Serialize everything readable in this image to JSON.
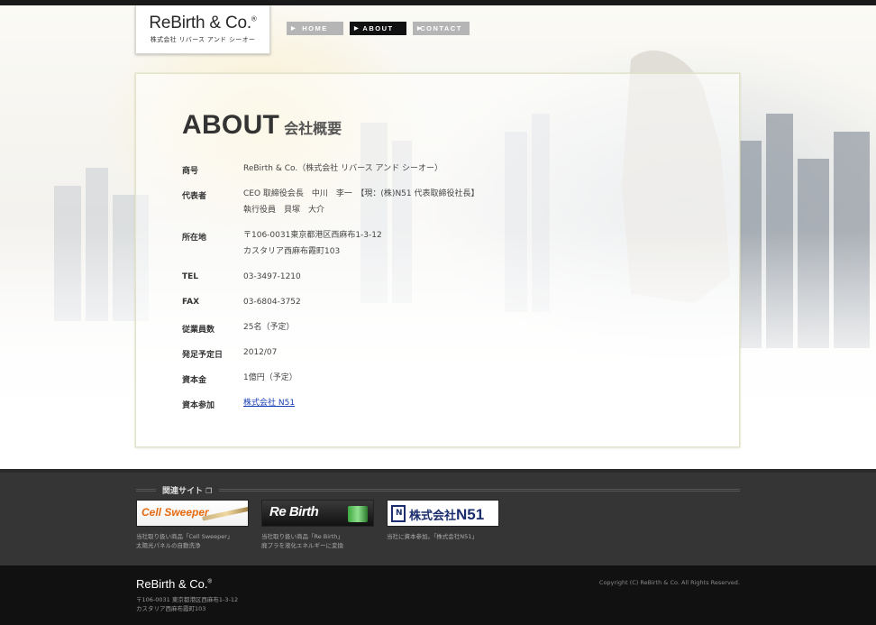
{
  "brand": {
    "logo_main": "ReBirth & Co.",
    "logo_mark": "®",
    "logo_sub": "株式会社 リバース アンド シーオー"
  },
  "nav": {
    "items": [
      {
        "label": "HOME",
        "active": false
      },
      {
        "label": "ABOUT",
        "active": true
      },
      {
        "label": "CONTACT",
        "active": false
      }
    ]
  },
  "page": {
    "title_en": "ABOUT",
    "title_ja": "会社概要"
  },
  "company": {
    "rows": [
      {
        "label": "商号",
        "lines": [
          "ReBirth & Co.（株式会社 リバース アンド シーオー）"
        ]
      },
      {
        "label": "代表者",
        "lines": [
          "CEO 取締役会長　中川　李一　【現：(株)N51 代表取締役社長】",
          "執行役員　貝塚　大介"
        ]
      },
      {
        "label": "所在地",
        "lines": [
          "〒106-0031東京都港区西麻布1-3-12",
          "カスタリア西麻布霞町103"
        ]
      },
      {
        "label": "TEL",
        "lines": [
          "03-3497-1210"
        ]
      },
      {
        "label": "FAX",
        "lines": [
          "03-6804-3752"
        ]
      },
      {
        "label": "従業員数",
        "lines": [
          "25名（予定）"
        ]
      },
      {
        "label": "発足予定日",
        "lines": [
          "2012/07"
        ]
      },
      {
        "label": "資本金",
        "lines": [
          "1億円（予定）"
        ]
      },
      {
        "label": "資本参加",
        "link": "株式会社 N51"
      }
    ]
  },
  "related": {
    "title": "関連サイト",
    "banners": [
      {
        "name": "Cell Sweeper",
        "caption1": "当社取り扱い商品「Cell Sweeper」",
        "caption2": "太陽光パネルの自動洗浄"
      },
      {
        "name": "Re Birth",
        "caption1": "当社取り扱い商品「Re Birth」",
        "caption2": "廃プラを液化エネルギーに変換"
      },
      {
        "name_prefix": "株式会社",
        "name": "N51",
        "mark": "N",
        "caption1": "当社に資本参加。「株式会社N51」",
        "caption2": ""
      }
    ]
  },
  "footer": {
    "logo": "ReBirth & Co.",
    "logo_mark": "®",
    "address1": "〒106-0031 東京都港区西麻布1-3-12",
    "address2": "カスタリア西麻布霞町103",
    "copyright": "Copyright (C) ReBirth & Co. All Rights Reserved."
  }
}
